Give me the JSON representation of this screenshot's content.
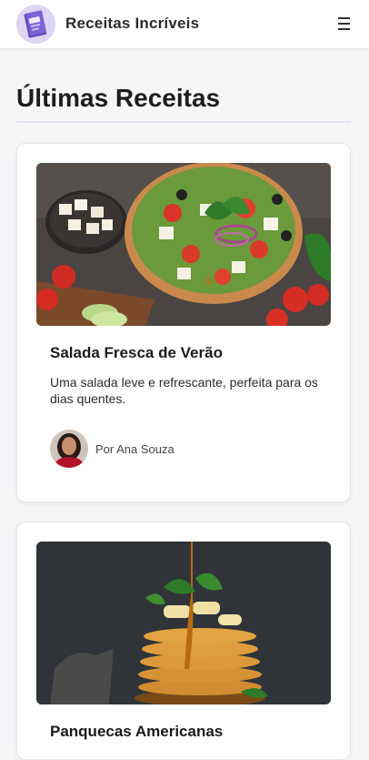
{
  "header": {
    "brand": "Receitas Incríveis",
    "logo_icon": "recipe-book-icon",
    "menu_icon": "hamburger-menu-icon"
  },
  "main": {
    "section_title": "Últimas Receitas",
    "recipes": [
      {
        "title": "Salada Fresca de Verão",
        "description": "Uma salada leve e refrescante, perfeita para os dias quentes.",
        "author": "Por Ana Souza",
        "image": "greek-salad-photo"
      },
      {
        "title": "Panquecas Americanas",
        "image": "pancakes-photo"
      }
    ]
  },
  "colors": {
    "background": "#f5f6f8",
    "card": "#ffffff",
    "accent_rule": "#e3e6f3"
  }
}
